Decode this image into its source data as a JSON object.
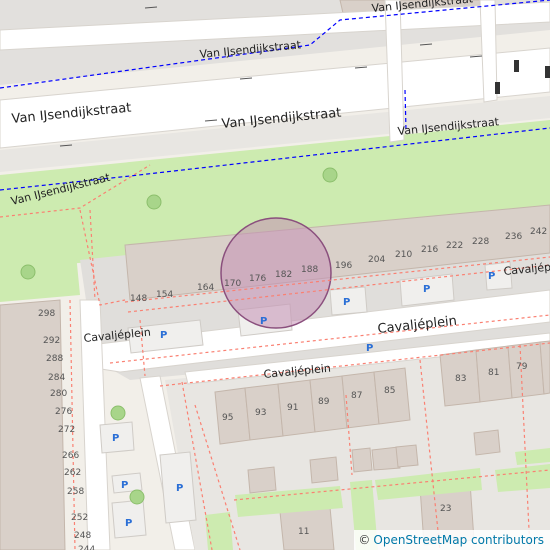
{
  "map": {
    "streets": {
      "main_street": "Van IJsendijkstraat",
      "square_street": "Cavaljéplein"
    },
    "house_numbers": {
      "north_row": [
        "148",
        "154",
        "164",
        "170",
        "176",
        "182",
        "188",
        "196",
        "204",
        "210",
        "216",
        "222",
        "228",
        "236",
        "242"
      ],
      "west_column": [
        "298",
        "292",
        "288",
        "284",
        "280",
        "276",
        "272",
        "266",
        "262",
        "258",
        "252",
        "248",
        "244"
      ],
      "block_south": [
        "95",
        "93",
        "91",
        "89",
        "87",
        "85"
      ],
      "block_east": [
        "83",
        "81",
        "79"
      ],
      "misc": [
        "23",
        "11"
      ]
    },
    "parking_symbol": "P",
    "colors": {
      "background": "#f2efe9",
      "road": "#ffffff",
      "grass": "#cdebb0",
      "building": "#d9d0c9",
      "building_outline": "#c4b6ab",
      "footway": "#fa8072",
      "cycleway": "#0000ff",
      "highlight_fill": "#c490b4",
      "highlight_stroke": "#8a4f7d"
    }
  },
  "attribution": {
    "symbol": "©",
    "text": "OpenStreetMap contributors"
  }
}
